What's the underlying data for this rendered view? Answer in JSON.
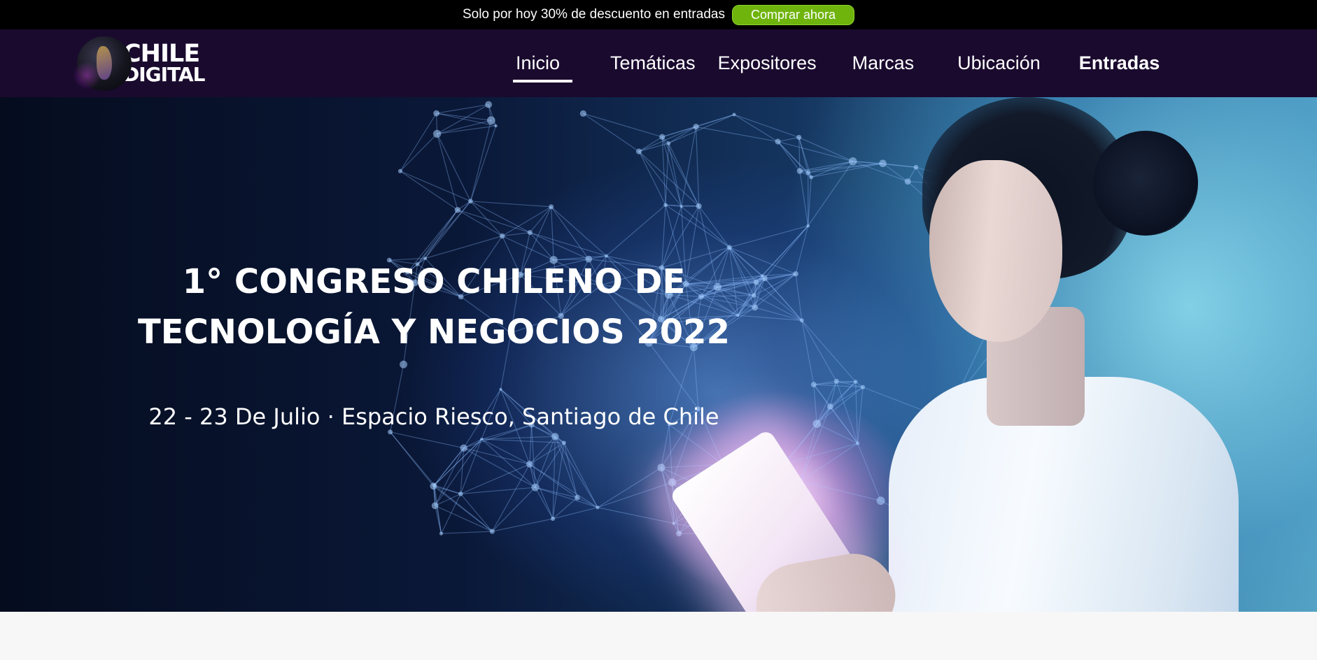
{
  "promo": {
    "text": "Solo por hoy 30% de descuento en entradas",
    "button_label": "Comprar ahora",
    "button_color": "#6fb40d"
  },
  "header": {
    "logo_line1": "CHILE",
    "logo_line2": "DIGITAL",
    "background": "#1a0a2e",
    "nav": [
      {
        "label": "Inicio",
        "active": true
      },
      {
        "label": "Temáticas",
        "active": false
      },
      {
        "label": "Expositores",
        "active": false
      },
      {
        "label": "Marcas",
        "active": false
      },
      {
        "label": "Ubicación",
        "active": false
      },
      {
        "label": "Entradas",
        "active": false,
        "bold": true
      }
    ]
  },
  "hero": {
    "title_line1": "1° CONGRESO CHILENO DE",
    "title_line2": "TECNOLOGÍA Y NEGOCIOS 2022",
    "subtitle": "22 - 23 De Julio · Espacio Riesco, Santiago de Chile"
  }
}
